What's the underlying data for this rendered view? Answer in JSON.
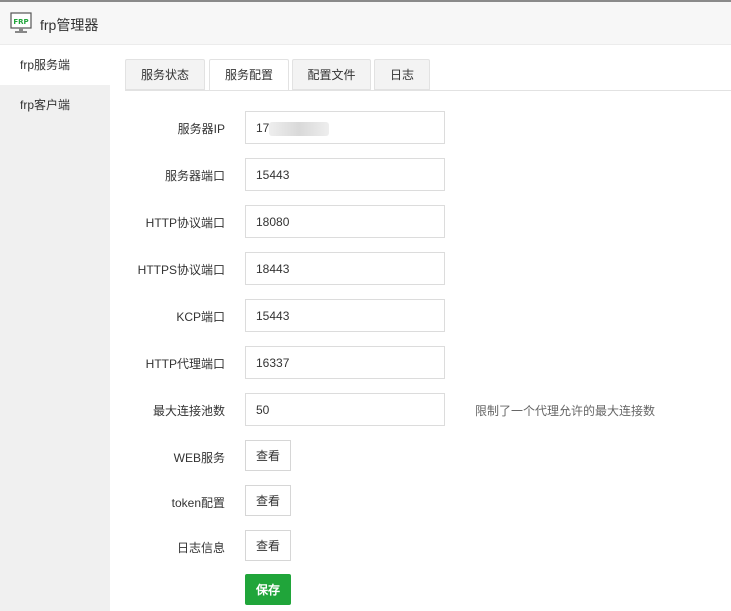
{
  "app": {
    "title": "frp管理器",
    "icon": "frp-monitor-icon",
    "icon_text": "FRP"
  },
  "sidebar": {
    "items": [
      {
        "label": "frp服务端",
        "active": true
      },
      {
        "label": "frp客户端",
        "active": false
      }
    ]
  },
  "tabs": [
    {
      "label": "服务状态",
      "active": false
    },
    {
      "label": "服务配置",
      "active": true
    },
    {
      "label": "配置文件",
      "active": false
    },
    {
      "label": "日志",
      "active": false
    }
  ],
  "form": {
    "server_ip": {
      "label": "服务器IP",
      "value": "17            38"
    },
    "server_port": {
      "label": "服务器端口",
      "value": "15443"
    },
    "http_port": {
      "label": "HTTP协议端口",
      "value": "18080"
    },
    "https_port": {
      "label": "HTTPS协议端口",
      "value": "18443"
    },
    "kcp_port": {
      "label": "KCP端口",
      "value": "15443"
    },
    "http_proxy_port": {
      "label": "HTTP代理端口",
      "value": "16337"
    },
    "max_pool": {
      "label": "最大连接池数",
      "value": "50",
      "hint": "限制了一个代理允许的最大连接数"
    },
    "web_service": {
      "label": "WEB服务",
      "button": "查看"
    },
    "token_config": {
      "label": "token配置",
      "button": "查看"
    },
    "log_info": {
      "label": "日志信息",
      "button": "查看"
    },
    "save_button": "保存"
  },
  "colors": {
    "accent": "#20a53a",
    "sidebar_bg": "#f0f0f0"
  }
}
